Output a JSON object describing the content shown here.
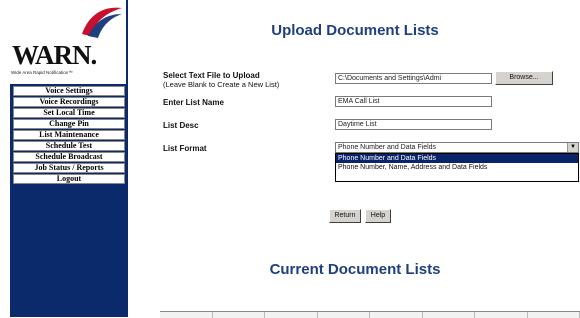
{
  "logo": {
    "text": "WARN.",
    "tagline": "Wide Area Rapid Notification™"
  },
  "menu": [
    "Voice Settings",
    "Voice Recordings",
    "Set Local Time",
    "Change Pin",
    "List Maintenance",
    "Schedule Test",
    "Schedule Broadcast",
    "Job Status / Reports",
    "Logout"
  ],
  "upload": {
    "title": "Upload Document Lists",
    "select_label": "Select Text File to Upload",
    "select_sublabel": "(Leave Blank to Create a New List)",
    "file_value": "C:\\Documents and Settings\\Admi",
    "browse_label": "Browse...",
    "list_name_label": "Enter List Name",
    "list_name_value": "EMA Call List",
    "list_desc_label": "List Desc",
    "list_desc_value": "Daytime List",
    "list_format_label": "List Format",
    "list_format_value": "Phone Number and Data Fields",
    "options": [
      "Phone Number and Data Fields",
      "Phone Number, Name, Address and Data Fields"
    ],
    "selected_option_index": 0,
    "return_label": "Return",
    "help_label": "Help"
  },
  "current": {
    "title": "Current Document Lists"
  },
  "colors": {
    "sidebar_bg": "#0b2a6c",
    "title_color": "#1f3f7e",
    "selected_option_bg": "#0a246a"
  }
}
